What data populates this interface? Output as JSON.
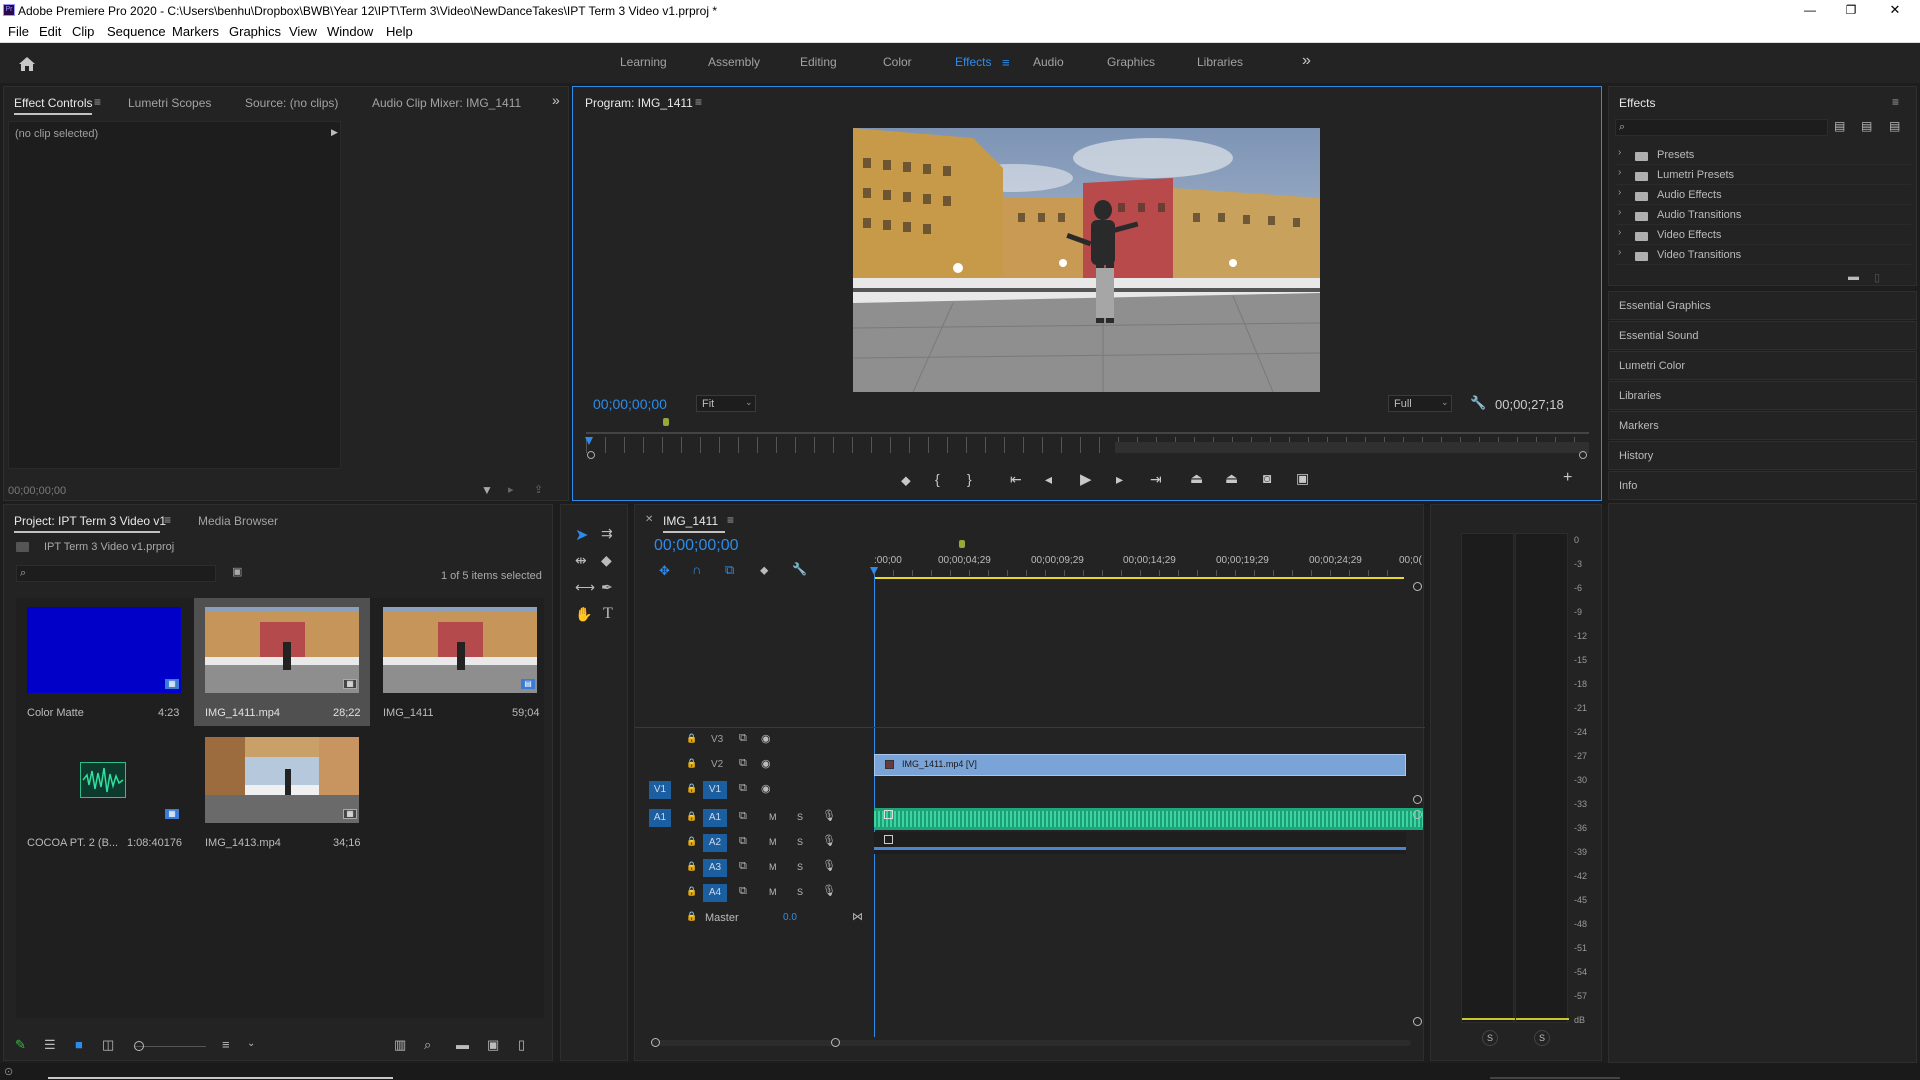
{
  "app": {
    "title": "Adobe Premiere Pro 2020 - C:\\Users\\benhu\\Dropbox\\BWB\\Year 12\\IPT\\Term 3\\Video\\NewDanceTakes\\IPT Term 3 Video v1.prproj *",
    "icon_label": "Pr"
  },
  "window_controls": {
    "minimize": "—",
    "restore": "❐",
    "close": "✕"
  },
  "menu": [
    "File",
    "Edit",
    "Clip",
    "Sequence",
    "Markers",
    "Graphics",
    "View",
    "Window",
    "Help"
  ],
  "workspaces": {
    "items": [
      "Learning",
      "Assembly",
      "Editing",
      "Color",
      "Effects",
      "Audio",
      "Graphics",
      "Libraries"
    ],
    "active": "Effects",
    "more": "»"
  },
  "source_panel": {
    "tabs": [
      "Effect Controls",
      "Lumetri Scopes",
      "Source: (no clips)",
      "Audio Clip Mixer: IMG_1411"
    ],
    "no_clip": "(no clip selected)",
    "timecode": "00;00;00;00"
  },
  "program_monitor": {
    "title": "Program: IMG_1411",
    "timecode": "00;00;00;00",
    "fit": "Fit",
    "quality": "Full",
    "duration": "00;00;27;18"
  },
  "effects_panel": {
    "title": "Effects",
    "folders": [
      "Presets",
      "Lumetri Presets",
      "Audio Effects",
      "Audio Transitions",
      "Video Effects",
      "Video Transitions"
    ],
    "collapsed_panels": [
      "Essential Graphics",
      "Essential Sound",
      "Lumetri Color",
      "Libraries",
      "Markers",
      "History",
      "Info"
    ]
  },
  "project_panel": {
    "tabs": [
      "Project: IPT Term 3 Video v1",
      "Media Browser"
    ],
    "file": "IPT Term 3 Video v1.prproj",
    "selection": "1 of 5 items selected",
    "items": [
      {
        "name": "Color Matte",
        "duration": "4:23"
      },
      {
        "name": "IMG_1411.mp4",
        "duration": "28;22"
      },
      {
        "name": "IMG_1411",
        "duration": "59;04"
      },
      {
        "name": "COCOA PT. 2 (B...",
        "duration": "1:08:40176"
      },
      {
        "name": "IMG_1413.mp4",
        "duration": "34;16"
      }
    ]
  },
  "timeline": {
    "title": "IMG_1411",
    "timecode": "00;00;00;00",
    "ruler": [
      ":00;00",
      "00;00;04;29",
      "00;00;09;29",
      "00;00;14;29",
      "00;00;19;29",
      "00;00;24;29",
      "00;0("
    ],
    "video_tracks": [
      "V3",
      "V2",
      "V1"
    ],
    "audio_tracks": [
      "A1",
      "A2",
      "A3",
      "A4"
    ],
    "source_v": "V1",
    "source_a": "A1",
    "mute": "M",
    "solo": "S",
    "master_label": "Master",
    "master_value": "0.0",
    "clip_label": "IMG_1411.mp4 [V]"
  },
  "meter": {
    "scale": [
      "0",
      "-3",
      "-6",
      "-9",
      "-12",
      "-15",
      "-18",
      "-21",
      "-24",
      "-27",
      "-30",
      "-33",
      "-36",
      "-39",
      "-42",
      "-45",
      "-48",
      "-51",
      "-54",
      "-57",
      "dB"
    ],
    "solo_buttons": [
      "S",
      "S"
    ]
  },
  "colors": {
    "accent": "#2d8ceb",
    "clip_blue": "#7aa3d8",
    "audio_green": "#2fbf8c",
    "timeline_yellow": "#e8d82a"
  }
}
